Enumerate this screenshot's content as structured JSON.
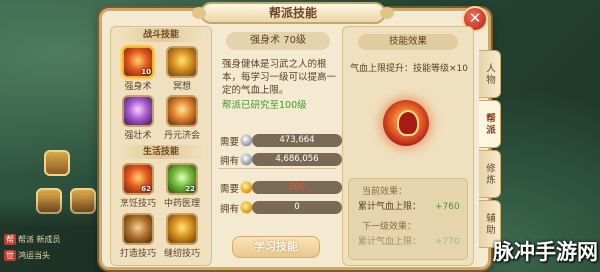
{
  "window": {
    "title": "帮派技能",
    "close_label": "✕"
  },
  "left": {
    "combat_section": "战斗技能",
    "life_section": "生活技能",
    "combat_skills": [
      {
        "name": "强身术",
        "level": "10",
        "icon": "strength-skill-icon",
        "selected": true
      },
      {
        "name": "冥想",
        "level": "",
        "icon": "meditation-skill-icon"
      },
      {
        "name": "强壮术",
        "level": "",
        "icon": "vigor-skill-icon"
      },
      {
        "name": "丹元济会",
        "level": "",
        "icon": "elixir-skill-icon"
      }
    ],
    "life_skills": [
      {
        "name": "烹饪技巧",
        "level": "62",
        "icon": "cooking-skill-icon"
      },
      {
        "name": "中药医理",
        "level": "22",
        "icon": "medicine-skill-icon"
      },
      {
        "name": "打造技巧",
        "level": "",
        "icon": "forging-skill-icon"
      },
      {
        "name": "缝纫技巧",
        "level": "",
        "icon": "sewing-skill-icon"
      }
    ]
  },
  "middle": {
    "skill_title": "强身术 70级",
    "description": "强身健体是习武之人的根本，每学习一级可以提高一定的气血上限。",
    "research_status": "帮派已研究至100级",
    "costs": [
      {
        "label": "需要",
        "coin": "silver-coin-icon",
        "value": "473,664"
      },
      {
        "label": "拥有",
        "coin": "silver-coin-icon",
        "value": "4,686,056",
        "has_plus": true
      },
      {
        "label": "需要",
        "coin": "gold-coin-icon",
        "value": "200",
        "red": true
      },
      {
        "label": "拥有",
        "coin": "gold-coin-icon",
        "value": "0"
      }
    ],
    "learn_button": "学习技能",
    "plus_label": "+"
  },
  "right": {
    "effect_title": "技能效果",
    "effect_text": "气血上限提升：技能等级×10",
    "current_title": "当前效果：",
    "current_stat": "累计气血上限：",
    "current_value": "+760",
    "next_title": "下一级效果：",
    "next_stat": "累计气血上限：",
    "next_value": "+770"
  },
  "tabs": [
    {
      "label": "人物",
      "active": false
    },
    {
      "label": "帮派",
      "active": true
    },
    {
      "label": "修炼",
      "active": false
    },
    {
      "label": "辅助",
      "active": false
    }
  ],
  "chat": [
    {
      "tag": "帮",
      "text": "帮派 新成员"
    },
    {
      "tag": "世",
      "text": "鸿运当头"
    }
  ],
  "watermark": "脉冲手游网"
}
